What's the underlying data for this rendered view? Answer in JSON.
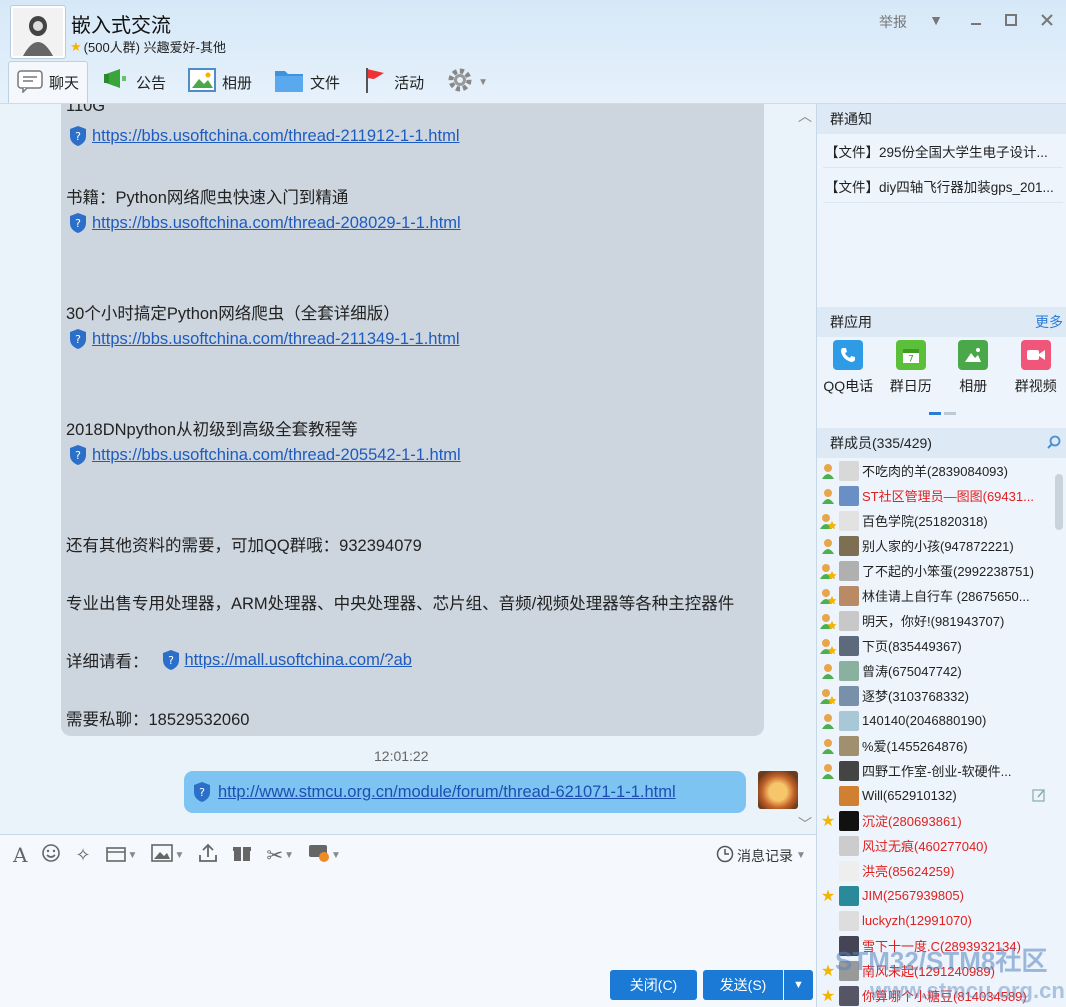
{
  "header": {
    "title": "嵌入式交流",
    "subtitle": "(500人群) 兴趣爱好-其他",
    "report_label": "举报"
  },
  "tabs": [
    {
      "label": "聊天",
      "icon": "chat-icon"
    },
    {
      "label": "公告",
      "icon": "announcement-icon"
    },
    {
      "label": "相册",
      "icon": "album-icon"
    },
    {
      "label": "文件",
      "icon": "folder-icon"
    },
    {
      "label": "活动",
      "icon": "flag-icon"
    }
  ],
  "chat": {
    "partial_top": "110G",
    "link1": "https://bbs.usoftchina.com/thread-211912-1-1.html",
    "line_book": "书籍：Python网络爬虫快速入门到精通",
    "link2": "https://bbs.usoftchina.com/thread-208029-1-1.html",
    "line_30h": "30个小时搞定Python网络爬虫（全套详细版）",
    "link3": "https://bbs.usoftchina.com/thread-211349-1-1.html",
    "line_2018": "2018DNpython从初级到高级全套教程等",
    "link4": "https://bbs.usoftchina.com/thread-205542-1-1.html",
    "line_qq": "还有其他资料的需要，可加QQ群哦：932394079",
    "line_sell": "专业出售专用处理器，ARM处理器、中央处理器、芯片组、音频/视频处理器等各种主控器件",
    "detail_label": "详细请看：",
    "detail_link": "https://mall.usoftchina.com/?ab",
    "line_pm": "需要私聊：18529532060",
    "timestamp": "12:01:22",
    "sent_link": "http://www.stmcu.org.cn/module/forum/thread-621071-1-1.html"
  },
  "composer": {
    "history_label": "消息记录",
    "close_label": "关闭(C)",
    "send_label": "发送(S)"
  },
  "right": {
    "notices_title": "群通知",
    "notices": [
      "【文件】295份全国大学生电子设计...",
      "【文件】diy四轴飞行器加装gps_201..."
    ],
    "apps_title": "群应用",
    "apps_more": "更多",
    "apps": [
      {
        "label": "QQ电话",
        "icon": "phone-icon",
        "color": "#2e9be6"
      },
      {
        "label": "群日历",
        "icon": "calendar-icon",
        "color": "#5cbf3a"
      },
      {
        "label": "相册",
        "icon": "album-icon",
        "color": "#4aa84a"
      },
      {
        "label": "群视频",
        "icon": "video-icon",
        "color": "#f0557a"
      }
    ],
    "members_title": "群成员(335/429)",
    "members": [
      {
        "name": "不吃肉的羊(2839084093)",
        "red": false,
        "badge": "admin"
      },
      {
        "name": "ST社区管理员—图图(69431...",
        "red": true,
        "badge": "admin"
      },
      {
        "name": "百色学院(251820318)",
        "red": false,
        "badge": "owner"
      },
      {
        "name": "别人家的小孩(947872221)",
        "red": false,
        "badge": "admin"
      },
      {
        "name": "了不起的小笨蛋(2992238751)",
        "red": false,
        "badge": "owner"
      },
      {
        "name": "林佳请上自行车 (28675650...",
        "red": false,
        "badge": "owner"
      },
      {
        "name": "明天，你好!(981943707)",
        "red": false,
        "badge": "owner"
      },
      {
        "name": "下页(835449367)",
        "red": false,
        "badge": "owner"
      },
      {
        "name": "曾涛(675047742)",
        "red": false,
        "badge": "admin"
      },
      {
        "name": "逐梦(3103768332)",
        "red": false,
        "badge": "owner"
      },
      {
        "name": "140140(2046880190)",
        "red": false,
        "badge": "admin"
      },
      {
        "name": "%爱(1455264876)",
        "red": false,
        "badge": "admin"
      },
      {
        "name": "四野工作室-创业-软硬件...",
        "red": false,
        "badge": "admin"
      },
      {
        "name": "Will(652910132)",
        "red": false,
        "badge": "none"
      },
      {
        "name": "沉淀(280693861)",
        "red": true,
        "badge": "star"
      },
      {
        "name": "风过无痕(460277040)",
        "red": true,
        "badge": "none"
      },
      {
        "name": "洪亮(85624259)",
        "red": true,
        "badge": "none"
      },
      {
        "name": "JIM(2567939805)",
        "red": true,
        "badge": "star"
      },
      {
        "name": "luckyzh(12991070)",
        "red": true,
        "badge": "none"
      },
      {
        "name": "雪下十一度.C(2893932134)",
        "red": true,
        "badge": "none"
      },
      {
        "name": "南风未起(1291240989)",
        "red": true,
        "badge": "star"
      },
      {
        "name": "你算哪个小糖豆(814034589)",
        "red": true,
        "badge": "star"
      }
    ]
  },
  "watermark": {
    "line1": "STM32/STM8社区",
    "line2": "www.stmcu.org.cn"
  }
}
